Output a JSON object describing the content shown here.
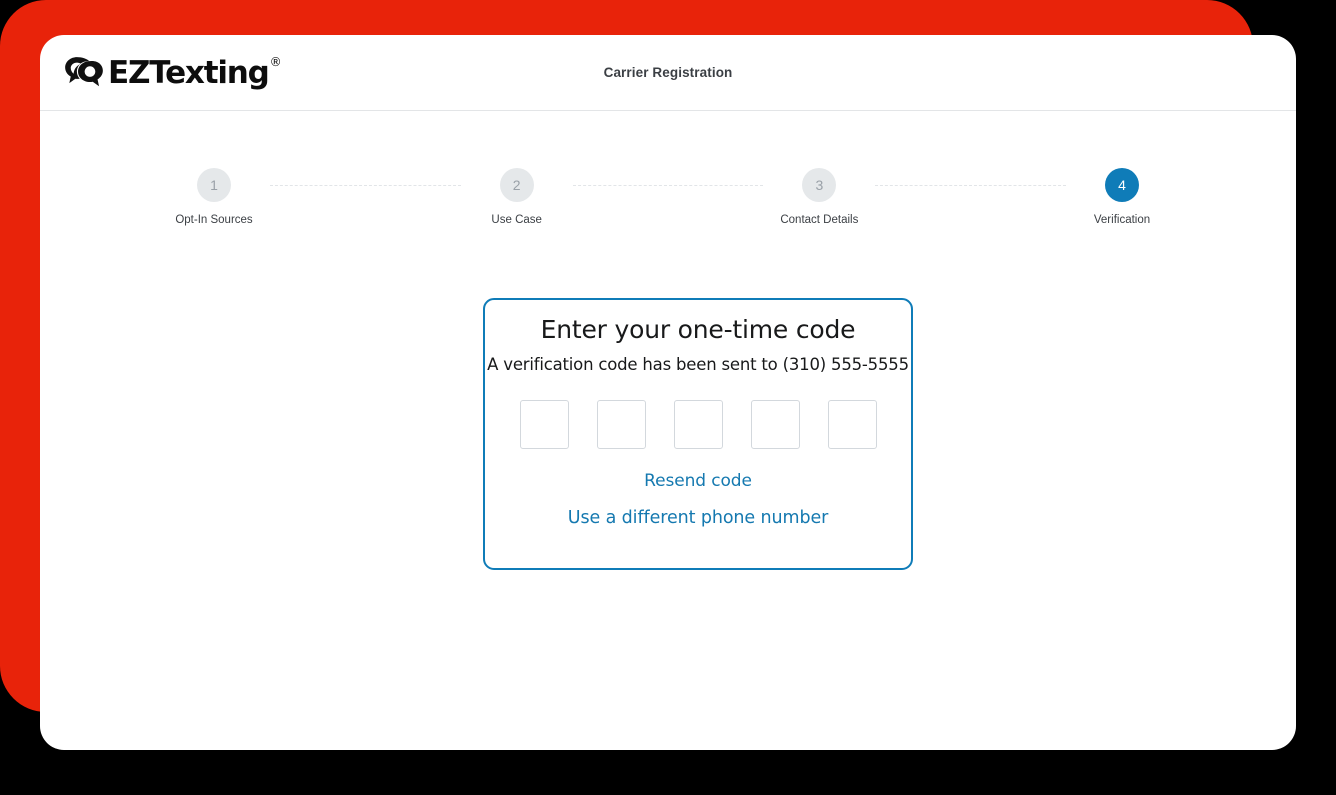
{
  "theme": {
    "accent_panel_color": "#e8230a",
    "brand_blue": "#0f7cb8",
    "link_blue": "#1579b0",
    "inactive_step_fill": "#e5e8ea",
    "inactive_step_text": "#9aa1a8",
    "card_border": "#0f7cb8",
    "input_border": "#d3d8dd"
  },
  "header": {
    "logo_text": "EZTexting",
    "logo_trademark": "®",
    "logo_icon": "eztexting-speech-bubble-logo",
    "title": "Carrier Registration"
  },
  "stepper": {
    "steps": [
      {
        "number": "1",
        "label": "Opt-In Sources",
        "active": false
      },
      {
        "number": "2",
        "label": "Use Case",
        "active": false
      },
      {
        "number": "3",
        "label": "Contact Details",
        "active": false
      },
      {
        "number": "4",
        "label": "Verification",
        "active": true
      }
    ]
  },
  "otp_card": {
    "title": "Enter your one-time code",
    "subtitle": "A verification code has been sent to (310) 555-5555",
    "phone_number": "(310) 555-5555",
    "code_digits": [
      "",
      "",
      "",
      "",
      ""
    ],
    "code_placeholder": "",
    "resend_label": "Resend code",
    "different_number_label": "Use a different phone number"
  }
}
